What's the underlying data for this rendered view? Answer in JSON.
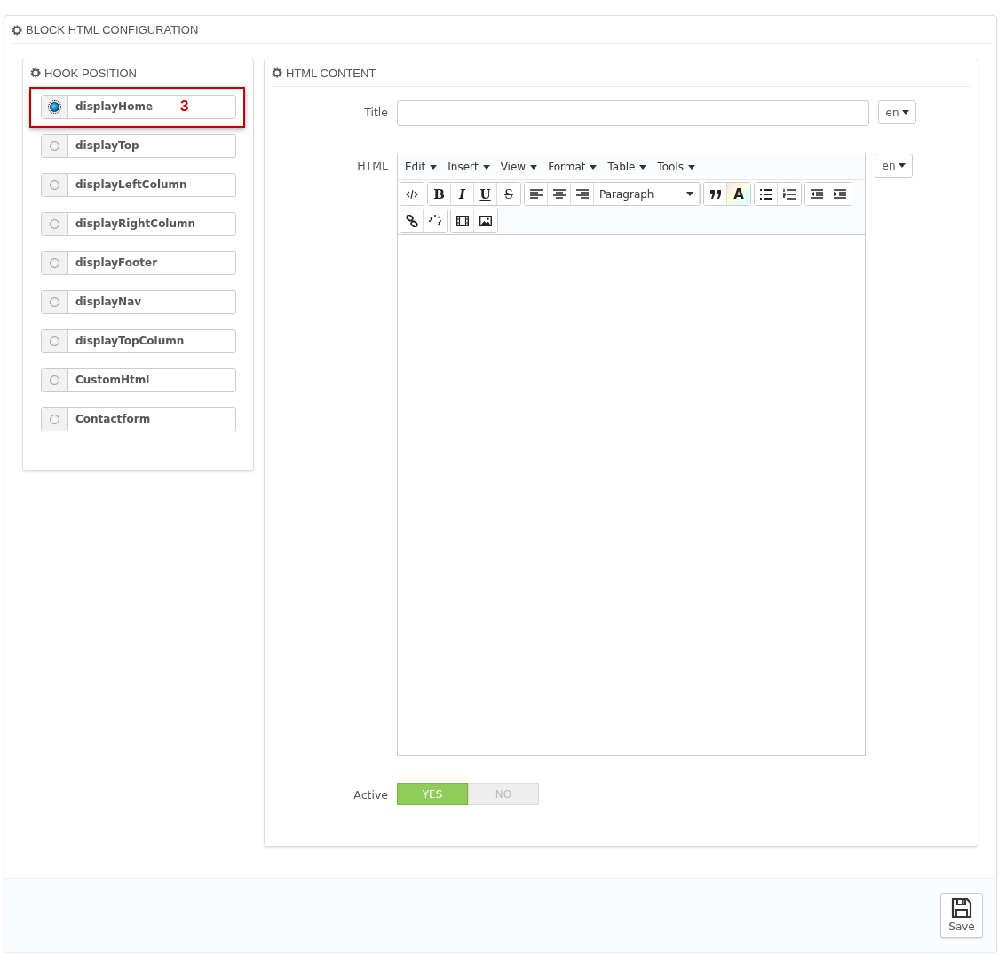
{
  "title": "BLOCK HTML CONFIGURATION",
  "hook_panel": {
    "title": "HOOK POSITION",
    "callout": "3",
    "items": [
      {
        "label": "displayHome",
        "selected": true
      },
      {
        "label": "displayTop",
        "selected": false
      },
      {
        "label": "displayLeftColumn",
        "selected": false
      },
      {
        "label": "displayRightColumn",
        "selected": false
      },
      {
        "label": "displayFooter",
        "selected": false
      },
      {
        "label": "displayNav",
        "selected": false
      },
      {
        "label": "displayTopColumn",
        "selected": false
      },
      {
        "label": "CustomHtml",
        "selected": false
      },
      {
        "label": "Contactform",
        "selected": false
      }
    ]
  },
  "content_panel": {
    "title": "HTML CONTENT",
    "title_field": {
      "label": "Title",
      "language": "en"
    },
    "html_field": {
      "label": "HTML",
      "language": "en",
      "menus": [
        "Edit",
        "Insert",
        "View",
        "Format",
        "Table",
        "Tools"
      ],
      "style_buttons": [
        {
          "label": "B",
          "kind": "bold"
        },
        {
          "label": "I",
          "kind": "italic"
        },
        {
          "label": "U",
          "kind": "underline"
        },
        {
          "label": "S",
          "kind": "strike"
        }
      ],
      "block_format": "Paragraph",
      "color_button": "A"
    },
    "active": {
      "label": "Active",
      "options": [
        {
          "label": "YES",
          "selected": true
        },
        {
          "label": "NO",
          "selected": false
        }
      ]
    }
  },
  "save_button": "Save"
}
